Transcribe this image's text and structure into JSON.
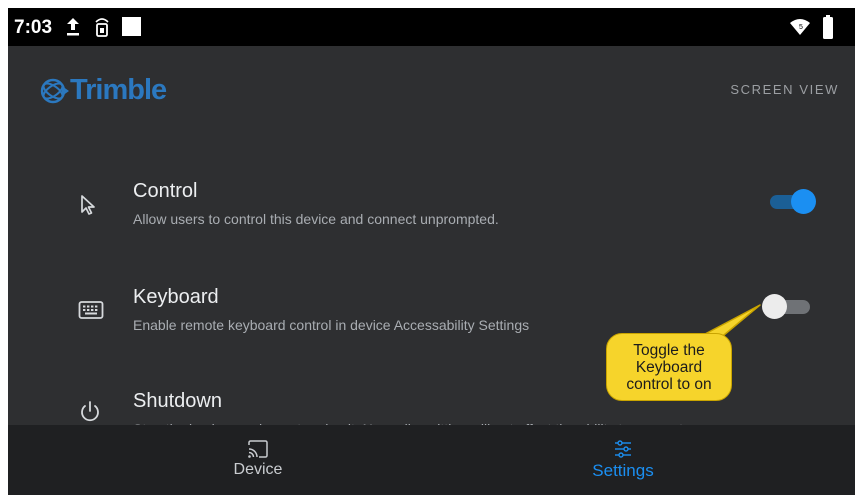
{
  "status_bar": {
    "time": "7:03",
    "icons": [
      "upload-icon",
      "sim-icon",
      "white-square-icon",
      "wifi-icon",
      "battery-icon"
    ]
  },
  "app": {
    "logo_text": "Trimble",
    "screen_view_label": "SCREEN VIEW"
  },
  "settings": [
    {
      "icon": "cursor-icon",
      "title": "Control",
      "description": "Allow users to control this device and connect unprompted.",
      "enabled": true
    },
    {
      "icon": "keyboard-icon",
      "title": "Keyboard",
      "description": "Enable remote keyboard control in device Accessability Settings",
      "enabled": false
    },
    {
      "icon": "power-icon",
      "title": "Shutdown",
      "description": "Stop the background agent and quit. Normally quitting will not affect the ability to connect"
    }
  ],
  "bottom_nav": [
    {
      "icon": "cast-icon",
      "label": "Device",
      "active": false
    },
    {
      "icon": "settings-sliders-icon",
      "label": "Settings",
      "active": true
    }
  ],
  "callout": {
    "lines": [
      "Toggle the",
      "Keyboard",
      "control to on"
    ]
  },
  "colors": {
    "background": "#2e2f31",
    "accent": "#1b8ff2",
    "brand": "#2b78bf",
    "callout": "#f6d42b"
  }
}
